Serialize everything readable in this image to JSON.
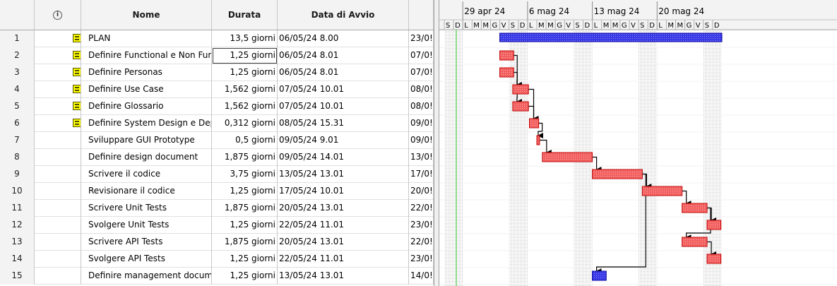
{
  "columns": {
    "indicators_icon": "info-icon",
    "name": "Nome",
    "duration": "Durata",
    "start": "Data di Avvio"
  },
  "tasks": [
    {
      "id": "1",
      "name": "PLAN",
      "duration": "13,5 giorni",
      "start": "06/05/24 8.00",
      "end": "23/0!",
      "icon": "task-notes-icon",
      "kind": "summary"
    },
    {
      "id": "2",
      "name": "Definire Functional e Non Fur",
      "duration": "1,25 giorni",
      "start": "06/05/24 8.01",
      "end": "07/0!",
      "icon": "task-notes-icon",
      "selected": true
    },
    {
      "id": "3",
      "name": "Definire Personas",
      "duration": "1,25 giorni",
      "start": "06/05/24 8.01",
      "end": "07/0!",
      "icon": "task-notes-icon"
    },
    {
      "id": "4",
      "name": "Definire Use Case",
      "duration": "1,562 giorni",
      "start": "07/05/24 10.01",
      "end": "08/0!",
      "icon": "task-notes-icon"
    },
    {
      "id": "5",
      "name": "Definire Glossario",
      "duration": "1,562 giorni",
      "start": "07/05/24 10.01",
      "end": "08/0!",
      "icon": "task-notes-icon"
    },
    {
      "id": "6",
      "name": "Definire System Design e Dep",
      "duration": "0,312 giorni",
      "start": "08/05/24 15.31",
      "end": "09/0!",
      "icon": "task-notes-icon"
    },
    {
      "id": "7",
      "name": "Sviluppare GUI Prototype",
      "duration": "0,5 giorni",
      "start": "09/05/24 9.01",
      "end": "09/0!"
    },
    {
      "id": "8",
      "name": "Definire design document",
      "duration": "1,875 giorni",
      "start": "09/05/24 14.01",
      "end": "13/0!"
    },
    {
      "id": "9",
      "name": "Scrivere il codice",
      "duration": "3,75 giorni",
      "start": "13/05/24 13.01",
      "end": "17/0!"
    },
    {
      "id": "10",
      "name": "Revisionare il codice",
      "duration": "1,25 giorni",
      "start": "17/05/24 10.01",
      "end": "20/0!"
    },
    {
      "id": "11",
      "name": "Scrivere Unit Tests",
      "duration": "1,875 giorni",
      "start": "20/05/24 13.01",
      "end": "22/0!"
    },
    {
      "id": "12",
      "name": "Svolgere Unit Tests",
      "duration": "1,25 giorni",
      "start": "22/05/24 11.01",
      "end": "23/0!"
    },
    {
      "id": "13",
      "name": "Scrivere API Tests",
      "duration": "1,875 giorni",
      "start": "20/05/24 13.01",
      "end": "22/0!"
    },
    {
      "id": "14",
      "name": "Svolgere API Tests",
      "duration": "1,25 giorni",
      "start": "22/05/24 11.01",
      "end": "23/0!"
    },
    {
      "id": "15",
      "name": "Definire management docum",
      "duration": "1,25 giorni",
      "start": "13/05/24 13.01",
      "end": "14/0!",
      "kind": "blue"
    }
  ],
  "timeline": {
    "weeks": [
      "29 apr 24",
      "6 mag 24",
      "13 mag 24",
      "20 mag 24"
    ],
    "day_letters": [
      "S",
      "D",
      "L",
      "M",
      "M",
      "G",
      "V",
      "S",
      "D",
      "L",
      "M",
      "M",
      "G",
      "V",
      "S",
      "D",
      "L",
      "M",
      "M",
      "G",
      "V",
      "S",
      "D",
      "L",
      "M",
      "M",
      "G",
      "V",
      "S",
      "D"
    ],
    "bars": [
      {
        "row": 1,
        "start_day": 6.0,
        "duration_days": 24.0,
        "style": "summary"
      },
      {
        "row": 2,
        "start_day": 6.0,
        "duration_days": 1.5,
        "style": "task"
      },
      {
        "row": 3,
        "start_day": 6.0,
        "duration_days": 1.5,
        "style": "task"
      },
      {
        "row": 4,
        "start_day": 7.4,
        "duration_days": 1.7,
        "style": "task"
      },
      {
        "row": 5,
        "start_day": 7.4,
        "duration_days": 1.7,
        "style": "task"
      },
      {
        "row": 6,
        "start_day": 9.2,
        "duration_days": 1.0,
        "style": "task"
      },
      {
        "row": 7,
        "start_day": 10.0,
        "duration_days": 0.3,
        "style": "task"
      },
      {
        "row": 8,
        "start_day": 10.6,
        "duration_days": 5.4,
        "style": "task"
      },
      {
        "row": 9,
        "start_day": 16.0,
        "duration_days": 5.4,
        "style": "task"
      },
      {
        "row": 10,
        "start_day": 21.4,
        "duration_days": 4.3,
        "style": "task"
      },
      {
        "row": 11,
        "start_day": 25.7,
        "duration_days": 2.7,
        "style": "task"
      },
      {
        "row": 12,
        "start_day": 28.4,
        "duration_days": 1.5,
        "style": "task"
      },
      {
        "row": 13,
        "start_day": 25.7,
        "duration_days": 2.7,
        "style": "task"
      },
      {
        "row": 14,
        "start_day": 28.4,
        "duration_days": 1.5,
        "style": "task"
      },
      {
        "row": 15,
        "start_day": 16.0,
        "duration_days": 1.5,
        "style": "blue"
      }
    ],
    "links": [
      [
        2,
        4
      ],
      [
        3,
        5
      ],
      [
        4,
        6
      ],
      [
        5,
        6
      ],
      [
        6,
        7
      ],
      [
        7,
        8
      ],
      [
        8,
        9
      ],
      [
        9,
        10
      ],
      [
        10,
        11
      ],
      [
        11,
        12
      ],
      [
        11,
        13
      ],
      [
        13,
        14
      ],
      [
        9,
        15
      ]
    ],
    "today_day": 1.3,
    "colors": {
      "task_fill": "#f26060",
      "task_border": "#c00000",
      "summary_fill": "#3a3ae6",
      "summary_border": "#0000a0",
      "today_line": "#33cc33",
      "weekend_shade": "#ececec"
    }
  }
}
